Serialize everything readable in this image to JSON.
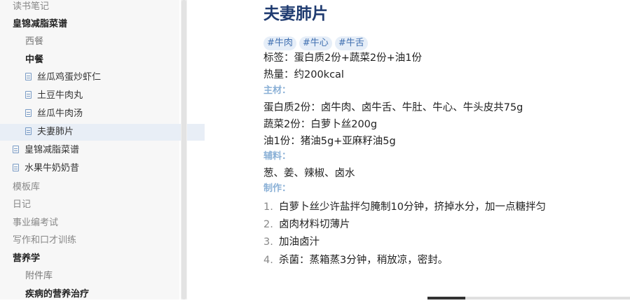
{
  "sidebar": {
    "items": [
      {
        "label": "读书笔记"
      },
      {
        "label": "皇锦减脂菜谱"
      },
      {
        "label": "西餐"
      },
      {
        "label": "中餐"
      },
      {
        "label": "丝瓜鸡蛋炒虾仁"
      },
      {
        "label": "土豆牛肉丸"
      },
      {
        "label": "丝瓜牛肉汤"
      },
      {
        "label": "夫妻肺片"
      },
      {
        "label": "皇锦减脂菜谱"
      },
      {
        "label": "水果牛奶奶昔"
      },
      {
        "label": "模板库"
      },
      {
        "label": "日记"
      },
      {
        "label": "事业编考试"
      },
      {
        "label": "写作和口才训练"
      },
      {
        "label": "营养学"
      },
      {
        "label": "附件库"
      },
      {
        "label": "疾病的营养治疗"
      }
    ]
  },
  "note": {
    "title": "夫妻肺片",
    "tags": [
      "#牛肉",
      "#牛心",
      "#牛舌"
    ],
    "tag_line": "标签：蛋白质2份+蔬菜2份+油1份",
    "calorie_line": "热量：约200kcal",
    "main_heading": "主材：",
    "main_lines": [
      "蛋白质2份：卤牛肉、卤牛舌、牛肚、牛心、牛头皮共75g",
      "蔬菜2份：白萝卜丝200g",
      "油1份：猪油5g+亚麻籽油5g"
    ],
    "aux_heading": "辅料：",
    "aux_line": "葱、姜、辣椒、卤水",
    "steps_heading": "制作：",
    "steps": [
      {
        "num": "1.",
        "text": "白萝卜丝少许盐拌匀腌制10分钟，挤掉水分，加一点糖拌匀"
      },
      {
        "num": "2.",
        "text": "卤肉材料切薄片"
      },
      {
        "num": "3.",
        "text": "加油卤汁"
      },
      {
        "num": "4.",
        "text": "杀菌：蒸箱蒸3分钟，稍放凉，密封。"
      }
    ]
  }
}
